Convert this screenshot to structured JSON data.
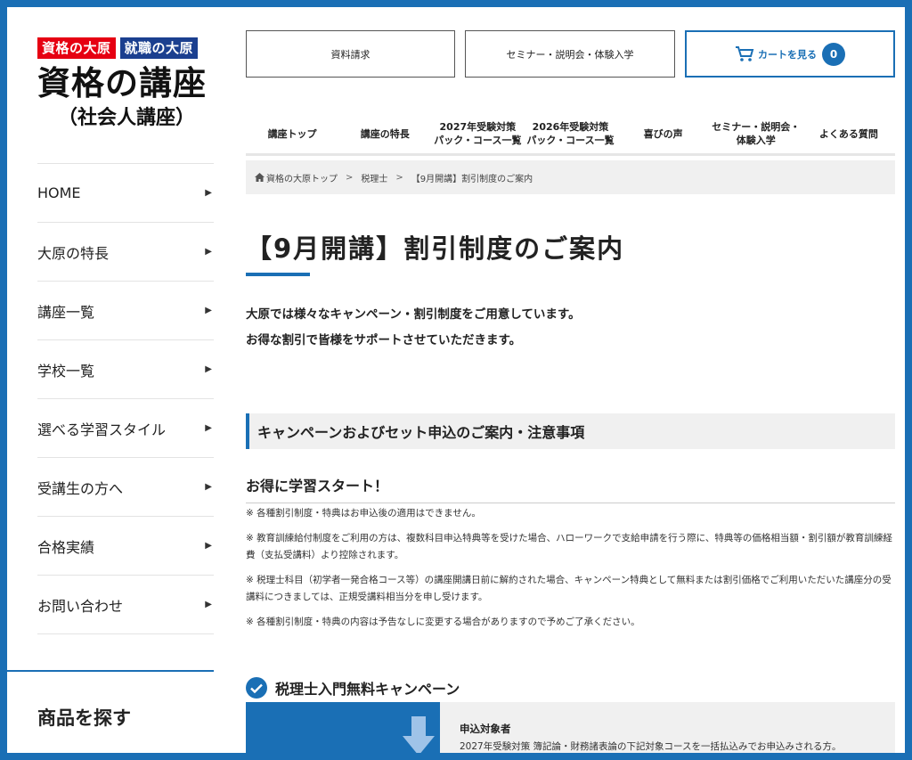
{
  "logo": {
    "badge_left": "資格の大原",
    "badge_right": "就職の大原",
    "title": "資格の講座",
    "subtitle": "（社会人講座）"
  },
  "sidebar": {
    "items": [
      {
        "label": "HOME"
      },
      {
        "label": "大原の特長"
      },
      {
        "label": "講座一覧"
      },
      {
        "label": "学校一覧"
      },
      {
        "label": "選べる学習スタイル"
      },
      {
        "label": "受講生の方へ"
      },
      {
        "label": "合格実績"
      },
      {
        "label": "お問い合わせ"
      }
    ],
    "search_title": "商品を探す"
  },
  "header": {
    "request_label": "資料請求",
    "seminar_label": "セミナー・説明会・体験入学",
    "cart_label": "カートを見る",
    "cart_count": "0"
  },
  "gnav": [
    {
      "line1": "講座トップ",
      "line2": ""
    },
    {
      "line1": "講座の特長",
      "line2": ""
    },
    {
      "line1": "2027年受験対策",
      "line2": "パック・コース一覧"
    },
    {
      "line1": "2026年受験対策",
      "line2": "パック・コース一覧"
    },
    {
      "line1": "喜びの声",
      "line2": ""
    },
    {
      "line1": "セミナー・説明会・",
      "line2": "体験入学"
    },
    {
      "line1": "よくある質問",
      "line2": ""
    }
  ],
  "breadcrumb": {
    "home": "資格の大原トップ",
    "sep": ">",
    "level2": "税理士",
    "current": "【9月開講】割引制度のご案内"
  },
  "main": {
    "title": "【9月開講】割引制度のご案内",
    "lead_1": "大原では様々なキャンペーン・割引制度をご用意しています。",
    "lead_2": "お得な割引で皆様をサポートさせていただきます。",
    "section_heading": "キャンペーンおよびセット申込のご案内・注意事項",
    "sub_heading": "お得に学習スタート！",
    "notes": [
      "※ 各種割引制度・特典はお申込後の適用はできません。",
      "※ 教育訓練給付制度をご利用の方は、複数科目申込特典等を受けた場合、ハローワークで支給申請を行う際に、特典等の価格相当額・割引額が教育訓練経費（支払受講料）より控除されます。",
      "※ 税理士科目（初学者一発合格コース等）の講座開講日前に解約された場合、キャンペーン特典として無料または割引価格でご利用いただいた講座分の受講料につきましては、正規受講料相当分を申し受けます。",
      "※ 各種割引制度・特典の内容は予告なしに変更する場合がありますので予めご了承ください。"
    ],
    "campaign_title": "税理士入門無料キャンペーン",
    "campaign_target_label": "申込対象者",
    "campaign_target_desc": "2027年受験対策 簿記論・財務諸表論の下記対象コースを一括払込みでお申込みされる方。"
  },
  "colors": {
    "brand_blue": "#1a6fb5",
    "badge_red": "#e60012",
    "badge_navy": "#1b3f8f",
    "gray_bg": "#f0f0f0"
  }
}
